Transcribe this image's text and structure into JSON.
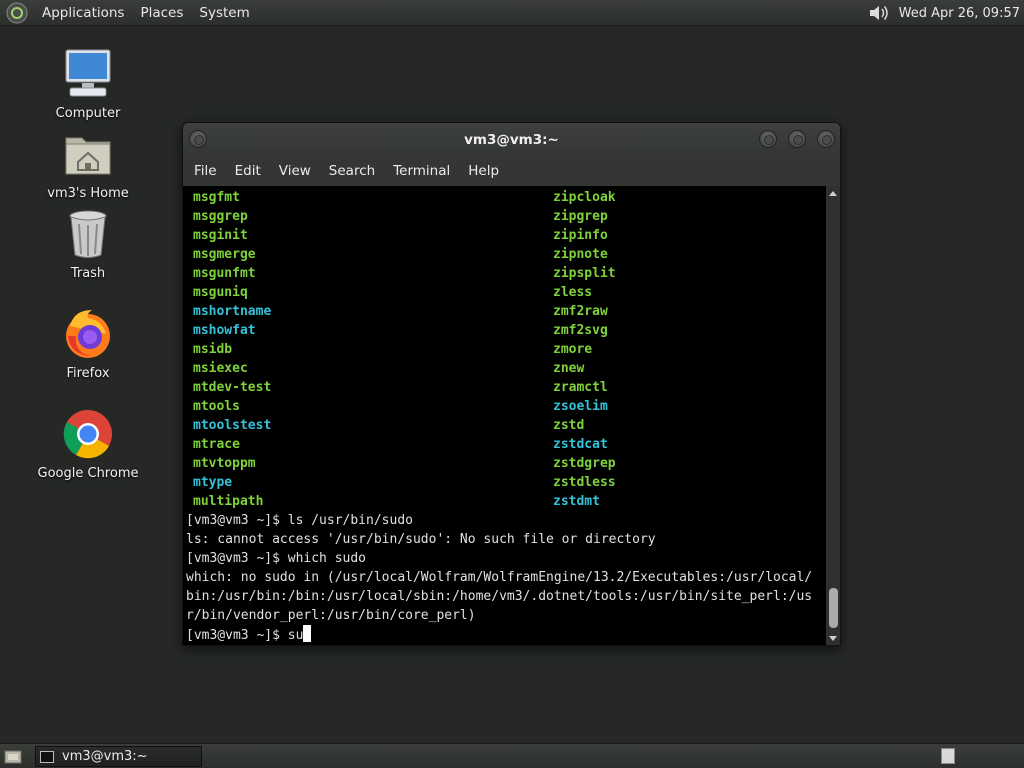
{
  "top_panel": {
    "menus": [
      "Applications",
      "Places",
      "System"
    ],
    "clock": "Wed Apr 26, 09:57"
  },
  "desktop_icons": [
    {
      "label": "Computer",
      "icon": "computer-icon"
    },
    {
      "label": "vm3's Home",
      "icon": "home-folder-icon"
    },
    {
      "label": "Trash",
      "icon": "trash-icon"
    },
    {
      "label": "Firefox",
      "icon": "firefox-icon"
    },
    {
      "label": "Google Chrome",
      "icon": "chrome-icon"
    }
  ],
  "terminal": {
    "title": "vm3@vm3:~",
    "menus": [
      "File",
      "Edit",
      "View",
      "Search",
      "Terminal",
      "Help"
    ],
    "listing": [
      [
        {
          "text": "msgfmt",
          "color": "green"
        },
        {
          "text": "zipcloak",
          "color": "green"
        }
      ],
      [
        {
          "text": "msggrep",
          "color": "green"
        },
        {
          "text": "zipgrep",
          "color": "green"
        }
      ],
      [
        {
          "text": "msginit",
          "color": "green"
        },
        {
          "text": "zipinfo",
          "color": "green"
        }
      ],
      [
        {
          "text": "msgmerge",
          "color": "green"
        },
        {
          "text": "zipnote",
          "color": "green"
        }
      ],
      [
        {
          "text": "msgunfmt",
          "color": "green"
        },
        {
          "text": "zipsplit",
          "color": "green"
        }
      ],
      [
        {
          "text": "msguniq",
          "color": "green"
        },
        {
          "text": "zless",
          "color": "green"
        }
      ],
      [
        {
          "text": "mshortname",
          "color": "cyan"
        },
        {
          "text": "zmf2raw",
          "color": "green"
        }
      ],
      [
        {
          "text": "mshowfat",
          "color": "cyan"
        },
        {
          "text": "zmf2svg",
          "color": "green"
        }
      ],
      [
        {
          "text": "msidb",
          "color": "green"
        },
        {
          "text": "zmore",
          "color": "green"
        }
      ],
      [
        {
          "text": "msiexec",
          "color": "green"
        },
        {
          "text": "znew",
          "color": "green"
        }
      ],
      [
        {
          "text": "mtdev-test",
          "color": "green"
        },
        {
          "text": "zramctl",
          "color": "green"
        }
      ],
      [
        {
          "text": "mtools",
          "color": "green"
        },
        {
          "text": "zsoelim",
          "color": "cyan"
        }
      ],
      [
        {
          "text": "mtoolstest",
          "color": "cyan"
        },
        {
          "text": "zstd",
          "color": "green"
        }
      ],
      [
        {
          "text": "mtrace",
          "color": "green"
        },
        {
          "text": "zstdcat",
          "color": "cyan"
        }
      ],
      [
        {
          "text": "mtvtoppm",
          "color": "green"
        },
        {
          "text": "zstdgrep",
          "color": "green"
        }
      ],
      [
        {
          "text": "mtype",
          "color": "cyan"
        },
        {
          "text": "zstdless",
          "color": "green"
        }
      ],
      [
        {
          "text": "multipath",
          "color": "green"
        },
        {
          "text": "zstdmt",
          "color": "cyan"
        }
      ]
    ],
    "output_lines": [
      "[vm3@vm3 ~]$ ls /usr/bin/sudo",
      "ls: cannot access '/usr/bin/sudo': No such file or directory",
      "[vm3@vm3 ~]$ which sudo",
      "which: no sudo in (/usr/local/Wolfram/WolframEngine/13.2/Executables:/usr/local/",
      "bin:/usr/bin:/bin:/usr/local/sbin:/home/vm3/.dotnet/tools:/usr/bin/site_perl:/us",
      "r/bin/vendor_perl:/usr/bin/core_perl)"
    ],
    "prompt": "[vm3@vm3 ~]$ ",
    "current_input": "su"
  },
  "taskbar": {
    "task_label": "vm3@vm3:~"
  }
}
